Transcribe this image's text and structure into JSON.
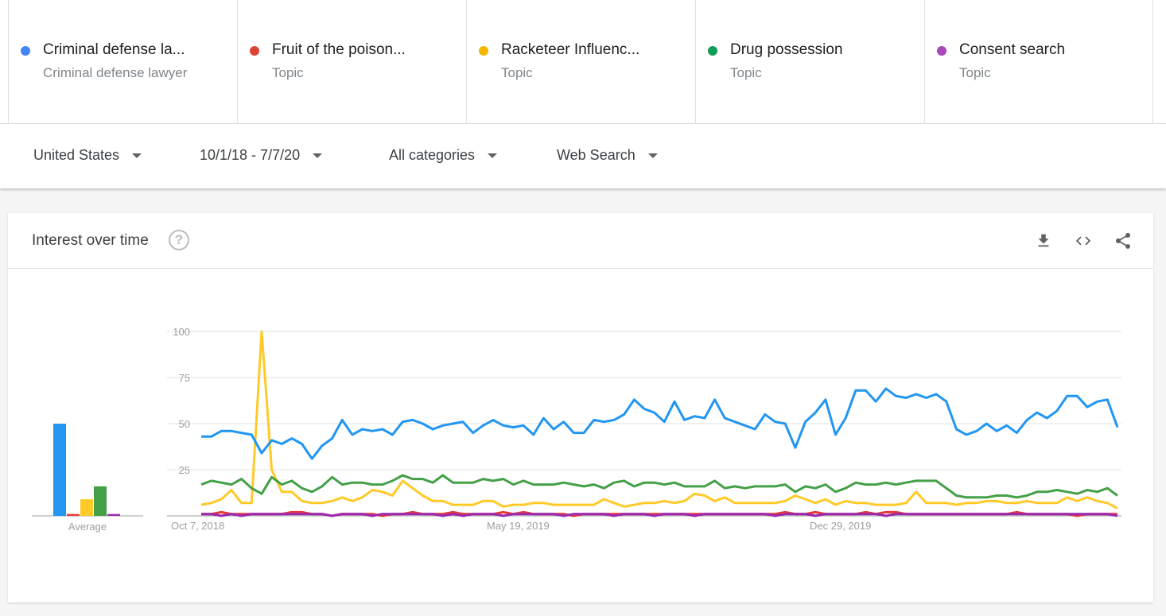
{
  "terms": [
    {
      "name": "Criminal defense la...",
      "sub": "Criminal defense lawyer",
      "color": "#4285f4"
    },
    {
      "name": "Fruit of the poison...",
      "sub": "Topic",
      "color": "#db4437"
    },
    {
      "name": "Racketeer Influenc...",
      "sub": "Topic",
      "color": "#f4b400"
    },
    {
      "name": "Drug possession",
      "sub": "Topic",
      "color": "#0f9d58"
    },
    {
      "name": "Consent search",
      "sub": "Topic",
      "color": "#ab47bc"
    }
  ],
  "filters": {
    "region": "United States",
    "date_range": "10/1/18 - 7/7/20",
    "category": "All categories",
    "search_type": "Web Search"
  },
  "card": {
    "title": "Interest over time",
    "help_icon": "?",
    "icons": [
      "download-icon",
      "embed-icon",
      "share-icon"
    ]
  },
  "chart_data": {
    "type": "line",
    "title": "",
    "ylim": [
      0,
      100
    ],
    "y_ticks": [
      "100",
      "75",
      "50",
      "25"
    ],
    "x_labels": [
      "Oct 7, 2018",
      "May 19, 2019",
      "Dec 29, 2019"
    ],
    "average_label": "Average",
    "grid": true,
    "series": [
      {
        "name": "Criminal defense lawyer",
        "color": "#2196f3",
        "average": 50,
        "values": [
          43,
          43,
          46,
          46,
          45,
          44,
          34,
          41,
          39,
          42,
          39,
          31,
          38,
          42,
          52,
          44,
          47,
          46,
          47,
          44,
          51,
          52,
          50,
          47,
          49,
          50,
          51,
          45,
          49,
          52,
          49,
          48,
          49,
          44,
          53,
          47,
          51,
          45,
          45,
          52,
          51,
          52,
          55,
          63,
          58,
          56,
          51,
          62,
          52,
          54,
          53,
          63,
          53,
          51,
          49,
          47,
          55,
          51,
          50,
          37,
          51,
          56,
          63,
          44,
          53,
          68,
          68,
          62,
          69,
          65,
          64,
          66,
          64,
          66,
          62,
          47,
          44,
          46,
          50,
          46,
          49,
          45,
          52,
          56,
          53,
          57,
          65,
          65,
          59,
          62,
          63,
          48
        ]
      },
      {
        "name": "Fruit of the poisonous tree",
        "color": "#e53935",
        "average": 1,
        "values": [
          1,
          1,
          2,
          1,
          1,
          1,
          1,
          1,
          1,
          2,
          2,
          1,
          1,
          0,
          1,
          1,
          1,
          1,
          0,
          1,
          1,
          2,
          1,
          1,
          1,
          2,
          1,
          1,
          1,
          1,
          2,
          1,
          2,
          1,
          1,
          1,
          1,
          0,
          1,
          1,
          1,
          1,
          1,
          1,
          1,
          1,
          1,
          1,
          1,
          1,
          1,
          1,
          1,
          1,
          1,
          1,
          1,
          1,
          2,
          1,
          1,
          2,
          1,
          1,
          1,
          1,
          2,
          1,
          2,
          2,
          1,
          1,
          1,
          1,
          1,
          1,
          1,
          1,
          1,
          1,
          1,
          2,
          1,
          1,
          1,
          1,
          1,
          0,
          1,
          1,
          1,
          1
        ]
      },
      {
        "name": "Racketeer Influenced and Corrupt Organizations Act",
        "color": "#ffca28",
        "average": 9,
        "values": [
          6,
          7,
          9,
          14,
          7,
          7,
          100,
          25,
          13,
          13,
          8,
          7,
          7,
          8,
          10,
          8,
          10,
          14,
          13,
          11,
          19,
          15,
          11,
          8,
          8,
          6,
          6,
          6,
          8,
          8,
          5,
          6,
          6,
          7,
          7,
          6,
          6,
          6,
          6,
          6,
          9,
          7,
          5,
          6,
          7,
          7,
          8,
          7,
          8,
          12,
          11,
          8,
          10,
          7,
          7,
          7,
          7,
          7,
          8,
          11,
          9,
          7,
          9,
          6,
          8,
          7,
          7,
          6,
          6,
          6,
          7,
          13,
          7,
          7,
          7,
          6,
          7,
          7,
          8,
          8,
          7,
          7,
          8,
          7,
          7,
          7,
          10,
          8,
          10,
          8,
          7,
          4
        ]
      },
      {
        "name": "Drug possession",
        "color": "#43a047",
        "average": 16,
        "values": [
          17,
          19,
          18,
          17,
          20,
          15,
          12,
          21,
          17,
          19,
          15,
          13,
          16,
          21,
          17,
          18,
          18,
          17,
          17,
          19,
          22,
          20,
          20,
          18,
          22,
          18,
          18,
          18,
          20,
          19,
          20,
          17,
          19,
          17,
          17,
          17,
          18,
          17,
          16,
          17,
          15,
          18,
          19,
          16,
          18,
          18,
          17,
          18,
          16,
          16,
          16,
          19,
          15,
          16,
          15,
          16,
          16,
          16,
          17,
          13,
          16,
          15,
          17,
          13,
          15,
          18,
          17,
          17,
          18,
          17,
          18,
          19,
          19,
          19,
          15,
          11,
          10,
          10,
          10,
          11,
          11,
          10,
          11,
          13,
          13,
          14,
          13,
          12,
          14,
          13,
          15,
          11
        ]
      },
      {
        "name": "Consent search",
        "color": "#9c27b0",
        "average": 1,
        "values": [
          1,
          1,
          0,
          1,
          0,
          1,
          1,
          1,
          1,
          1,
          1,
          1,
          1,
          0,
          1,
          1,
          1,
          0,
          1,
          1,
          1,
          1,
          1,
          1,
          0,
          1,
          0,
          1,
          1,
          1,
          0,
          1,
          1,
          1,
          1,
          1,
          0,
          1,
          1,
          1,
          1,
          0,
          1,
          1,
          1,
          0,
          1,
          1,
          1,
          0,
          1,
          1,
          1,
          1,
          1,
          1,
          1,
          0,
          1,
          1,
          1,
          0,
          1,
          1,
          1,
          1,
          1,
          1,
          0,
          1,
          1,
          1,
          1,
          1,
          1,
          1,
          1,
          1,
          1,
          1,
          1,
          1,
          1,
          1,
          1,
          1,
          1,
          1,
          1,
          1,
          1,
          0
        ]
      }
    ]
  }
}
